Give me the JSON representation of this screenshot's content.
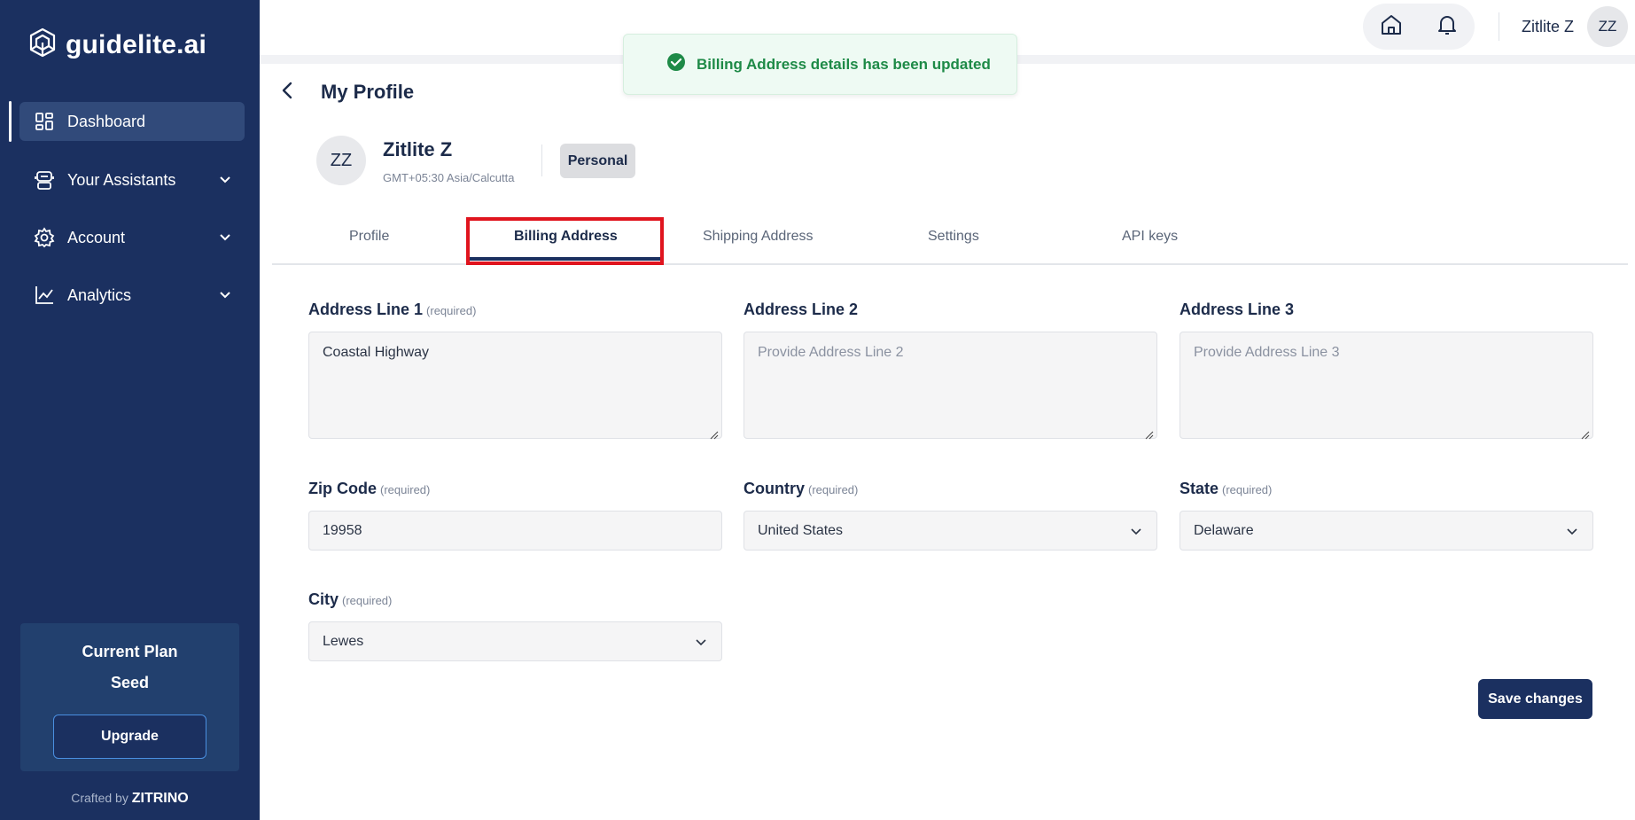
{
  "app": {
    "logo_text": "guidelite.ai"
  },
  "sidebar": {
    "items": [
      {
        "label": "Dashboard",
        "icon": "grid-icon",
        "active": true
      },
      {
        "label": "Your Assistants",
        "icon": "robot-icon",
        "expandable": true
      },
      {
        "label": "Account",
        "icon": "gear-icon",
        "expandable": true
      },
      {
        "label": "Analytics",
        "icon": "chart-icon",
        "expandable": true
      }
    ],
    "plan": {
      "title": "Current Plan",
      "name": "Seed",
      "upgrade_label": "Upgrade"
    },
    "crafted_prefix": "Crafted by",
    "crafted_brand": "ZITRINO"
  },
  "header": {
    "user_name": "Zitlite Z",
    "user_initials": "ZZ",
    "icons": [
      "home-icon",
      "bell-icon"
    ]
  },
  "toast": {
    "message": "Billing Address details has been updated",
    "status_color": "#1e8a47"
  },
  "page": {
    "title": "My Profile"
  },
  "profile": {
    "initials": "ZZ",
    "name": "Zitlite Z",
    "timezone": "GMT+05:30 Asia/Calcutta",
    "badge": "Personal"
  },
  "tabs": [
    {
      "label": "Profile",
      "active": false
    },
    {
      "label": "Billing Address",
      "active": true
    },
    {
      "label": "Shipping Address",
      "active": false
    },
    {
      "label": "Settings",
      "active": false
    },
    {
      "label": "API keys",
      "active": false
    }
  ],
  "form": {
    "required_text": "(required)",
    "address1": {
      "label": "Address Line 1",
      "value": "Coastal Highway"
    },
    "address2": {
      "label": "Address Line 2",
      "placeholder": "Provide Address Line 2"
    },
    "address3": {
      "label": "Address Line 3",
      "placeholder": "Provide Address Line 3"
    },
    "zip": {
      "label": "Zip Code",
      "value": "19958"
    },
    "country": {
      "label": "Country",
      "value": "United States"
    },
    "state": {
      "label": "State",
      "value": "Delaware"
    },
    "city": {
      "label": "City",
      "value": "Lewes"
    },
    "save_label": "Save changes"
  },
  "colors": {
    "sidebar_bg": "#1b3060",
    "accent": "#1b3060",
    "highlight": "#e0141e"
  }
}
